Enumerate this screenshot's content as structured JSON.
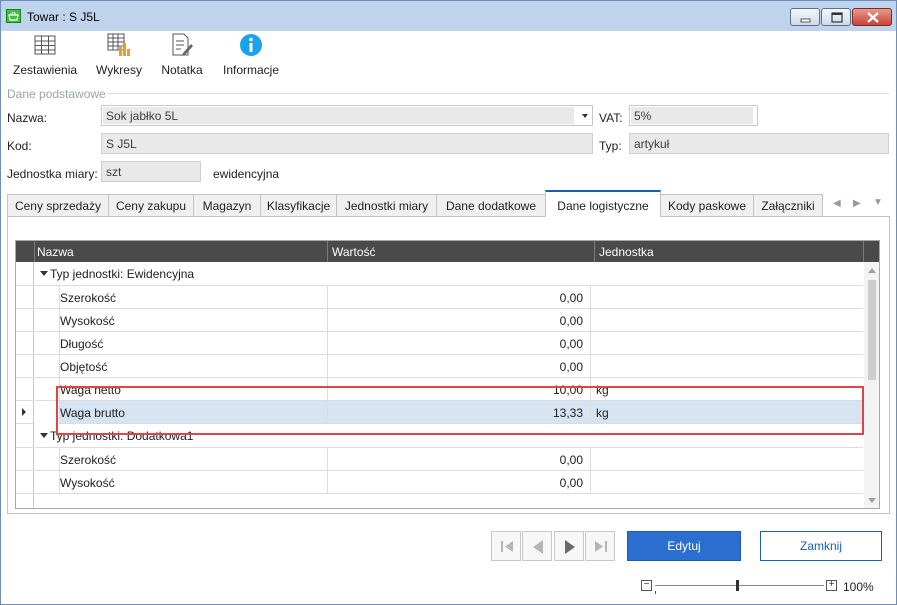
{
  "window": {
    "title": "Towar : S J5L"
  },
  "toolbar": {
    "items": [
      {
        "label": "Zestawienia",
        "icon": "table-icon"
      },
      {
        "label": "Wykresy",
        "icon": "chart-table-icon"
      },
      {
        "label": "Notatka",
        "icon": "note-edit-icon"
      },
      {
        "label": "Informacje",
        "icon": "info-icon"
      }
    ]
  },
  "basic": {
    "section": "Dane podstawowe",
    "name_label": "Nazwa:",
    "name_value": "Sok jabłko 5L",
    "vat_label": "VAT:",
    "vat_value": "5%",
    "code_label": "Kod:",
    "code_value": "S J5L",
    "type_label": "Typ:",
    "type_value": "artykuł",
    "unit_label": "Jednostka miary:",
    "unit_value": "szt",
    "unit_note": "ewidencyjna"
  },
  "tabs": [
    "Ceny sprzedaży",
    "Ceny zakupu",
    "Magazyn",
    "Klasyfikacje",
    "Jednostki miary",
    "Dane dodatkowe",
    "Dane logistyczne",
    "Kody paskowe",
    "Załączniki"
  ],
  "active_tab": "Dane logistyczne",
  "grid": {
    "headers": {
      "name": "Nazwa",
      "value": "Wartość",
      "unit": "Jednostka"
    },
    "groups": [
      {
        "label": "Typ jednostki: Ewidencyjna",
        "rows": [
          {
            "name": "Szerokość",
            "value": "0,00",
            "unit": ""
          },
          {
            "name": "Wysokość",
            "value": "0,00",
            "unit": ""
          },
          {
            "name": "Długość",
            "value": "0,00",
            "unit": ""
          },
          {
            "name": "Objętość",
            "value": "0,00",
            "unit": ""
          },
          {
            "name": "Waga netto",
            "value": "10,00",
            "unit": "kg"
          },
          {
            "name": "Waga brutto",
            "value": "13,33",
            "unit": "kg"
          }
        ]
      },
      {
        "label": "Typ jednostki: Dodatkowa1",
        "rows": [
          {
            "name": "Szerokość",
            "value": "0,00",
            "unit": ""
          },
          {
            "name": "Wysokość",
            "value": "0,00",
            "unit": ""
          }
        ]
      }
    ]
  },
  "buttons": {
    "edit": "Edytuj",
    "close": "Zamknij"
  },
  "zoom": {
    "level": "100%",
    "minus": "−",
    "plus": "+"
  },
  "colors": {
    "primary": "#2a6fcf",
    "highlight": "#e04545",
    "header": "#4a4a4a"
  }
}
